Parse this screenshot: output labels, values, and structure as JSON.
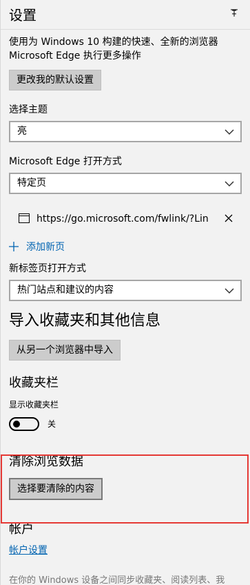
{
  "header": {
    "title": "设置",
    "pin_icon": "pin-icon"
  },
  "default_browser": {
    "line1": "使用为 Windows 10 构建的快速、全新的浏览器",
    "line2": "Microsoft Edge 执行更多操作",
    "button_label": "更改我的默认设置"
  },
  "theme": {
    "label": "选择主题",
    "value": "亮",
    "chevron_icon": "chevron-down-icon"
  },
  "open_with": {
    "label": "Microsoft Edge 打开方式",
    "value": "特定页",
    "chevron_icon": "chevron-down-icon"
  },
  "specific_pages": {
    "items": [
      {
        "url": "https://go.microsoft.com/fwlink/?Link",
        "page_icon": "page-icon",
        "remove_icon": "close-icon"
      }
    ],
    "add_label": "添加新页",
    "add_icon": "plus-icon"
  },
  "new_tab": {
    "label": "新标签页打开方式",
    "value": "热门站点和建议的内容",
    "chevron_icon": "chevron-down-icon"
  },
  "import": {
    "heading": "导入收藏夹和其他信息",
    "button_label": "从另一个浏览器中导入"
  },
  "favorites_bar": {
    "heading": "收藏夹栏",
    "show_label": "显示收藏夹栏",
    "toggle_state": "关",
    "toggle_on": false
  },
  "clear_data": {
    "heading": "清除浏览数据",
    "button_label": "选择要清除的内容",
    "highlight_color": "#e53935"
  },
  "account": {
    "heading": "帐户",
    "link_label": "帐户设置",
    "footer_text": "在你的 Windows 设备之间同步收藏夹、阅读列表、我"
  },
  "colors": {
    "background": "#f2f2f2",
    "accent": "#0063b1",
    "button_bg": "#cccccc",
    "highlight": "#e53935"
  }
}
